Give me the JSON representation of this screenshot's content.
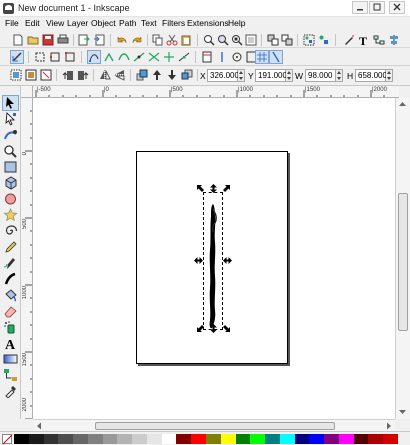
{
  "window": {
    "title": "New document 1 - Inkscape",
    "controls": [
      "minimize-icon",
      "maximize-icon",
      "close-icon"
    ]
  },
  "menu": {
    "items": [
      {
        "id": "file",
        "label": "File"
      },
      {
        "id": "edit",
        "label": "Edit"
      },
      {
        "id": "view",
        "label": "View"
      },
      {
        "id": "layer",
        "label": "Layer"
      },
      {
        "id": "object",
        "label": "Object"
      },
      {
        "id": "path",
        "label": "Path"
      },
      {
        "id": "text",
        "label": "Text"
      },
      {
        "id": "filters",
        "label": "Filters"
      },
      {
        "id": "extensions",
        "label": "Extensions"
      },
      {
        "id": "help",
        "label": "Help"
      }
    ]
  },
  "commands_bar": {
    "icons": [
      "new-document-icon",
      "open-icon",
      "save-icon",
      "print-icon",
      "import-icon",
      "export-icon",
      "undo-icon",
      "redo-icon",
      "copy-icon",
      "cut-icon",
      "paste-icon",
      "zoom-selection-icon",
      "zoom-drawing-icon",
      "zoom-page-icon",
      "duplicate-icon",
      "clone-icon",
      "unlink-clone-icon",
      "group-icon",
      "ungroup-icon",
      "fill-stroke-icon",
      "text-font-icon",
      "xml-editor-icon",
      "align-icon"
    ]
  },
  "snap_bar": {
    "icons": [
      "enable-snapping-icon",
      "snap-bbox-icon",
      "snap-bbox-edge-icon",
      "snap-bbox-corner-icon",
      "snap-nodes-icon",
      "snap-cusp-icon",
      "snap-smooth-icon",
      "snap-path-icon",
      "snap-intersection-icon",
      "snap-center-icon",
      "snap-page-icon",
      "show-grid-icon",
      "show-guides-icon"
    ]
  },
  "tool_controls": {
    "icons": [
      "select-all-icon",
      "select-all-layers-icon",
      "deselect-icon",
      "rotate-ccw-icon",
      "rotate-cw-icon",
      "flip-horizontal-icon",
      "flip-vertical-icon",
      "raise-to-top-icon",
      "raise-icon",
      "lower-icon",
      "lower-to-bottom-icon"
    ],
    "x": {
      "label": "X",
      "value": "326.000"
    },
    "y": {
      "label": "Y",
      "value": "191.000"
    },
    "w": {
      "label": "W",
      "value": "98.000"
    },
    "h": {
      "label": "H",
      "value": "658.000"
    }
  },
  "rulers": {
    "top_labels": [
      "|-500",
      "|0",
      "|500",
      "|1000",
      "|1500",
      "|2000"
    ],
    "left_labels": [
      "0",
      "500",
      "1000",
      "1500",
      "2000"
    ]
  },
  "toolbox": {
    "tools": [
      {
        "name": "selector-tool-icon",
        "active": true
      },
      {
        "name": "node-tool-icon",
        "active": false
      },
      {
        "name": "tweak-tool-icon",
        "active": false
      },
      {
        "name": "zoom-tool-icon",
        "active": false
      },
      {
        "name": "rectangle-tool-icon",
        "active": false
      },
      {
        "name": "3d-box-tool-icon",
        "active": false
      },
      {
        "name": "ellipse-tool-icon",
        "active": false
      },
      {
        "name": "star-tool-icon",
        "active": false
      },
      {
        "name": "spiral-tool-icon",
        "active": false
      },
      {
        "name": "pencil-tool-icon",
        "active": false
      },
      {
        "name": "pen-tool-icon",
        "active": false
      },
      {
        "name": "calligraphy-tool-icon",
        "active": false
      },
      {
        "name": "paint-bucket-tool-icon",
        "active": false
      },
      {
        "name": "eraser-tool-icon",
        "active": false
      },
      {
        "name": "spray-tool-icon",
        "active": false
      },
      {
        "name": "text-tool-icon",
        "active": false
      },
      {
        "name": "gradient-tool-icon",
        "active": false
      },
      {
        "name": "connector-tool-icon",
        "active": false
      },
      {
        "name": "dropper-tool-icon",
        "active": false
      }
    ]
  },
  "palette": {
    "colors": [
      "#000000",
      "#1a1a1a",
      "#333333",
      "#4d4d4d",
      "#666666",
      "#808080",
      "#999999",
      "#b3b3b3",
      "#cccccc",
      "#e6e6e6",
      "#ffffff",
      "#800000",
      "#ff0000",
      "#808000",
      "#ffff00",
      "#008000",
      "#00ff00",
      "#008080",
      "#00ffff",
      "#000080",
      "#0000ff",
      "#800080",
      "#ff00ff",
      "#550000",
      "#aa0000",
      "#d40000"
    ]
  }
}
